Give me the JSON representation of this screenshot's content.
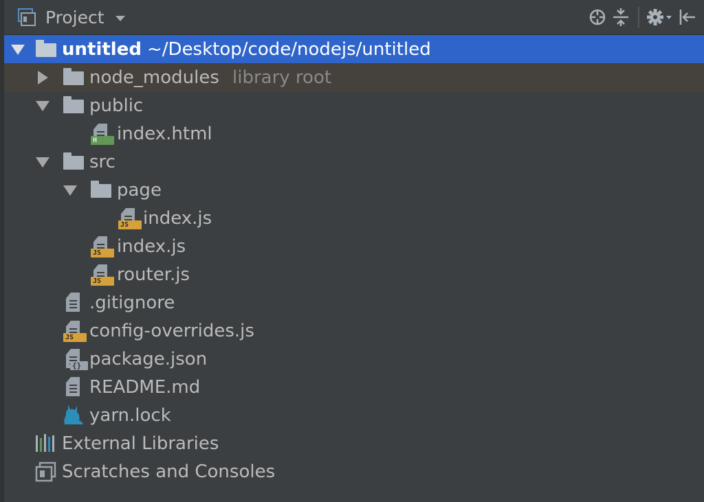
{
  "toolbar": {
    "title": "Project",
    "icons": [
      "project-view-icon",
      "dropdown-caret-icon",
      "locate-icon",
      "collapse-all-icon",
      "settings-gear-icon",
      "hide-panel-icon"
    ]
  },
  "tree": {
    "root": {
      "name": "untitled",
      "path": "~/Desktop/code/nodejs/untitled"
    },
    "node_modules": {
      "name": "node_modules",
      "note": "library root"
    },
    "public": {
      "name": "public",
      "index_html": "index.html"
    },
    "src": {
      "name": "src",
      "page": {
        "name": "page",
        "index_js": "index.js"
      },
      "index_js": "index.js",
      "router_js": "router.js"
    },
    "gitignore": ".gitignore",
    "config_overrides": "config-overrides.js",
    "package_json": "package.json",
    "readme": "README.md",
    "yarn_lock": "yarn.lock",
    "external_libraries": "External Libraries",
    "scratches": "Scratches and Consoles"
  },
  "badges": {
    "js": "JS",
    "html": "H",
    "json": "{}"
  },
  "colors": {
    "background": "#3c3f41",
    "selection": "#2f65ca",
    "library_root_highlight": "#45413c",
    "text": "#bbbbbb",
    "muted_text": "#8a8a8a",
    "js_badge": "#d6a13a",
    "html_badge": "#629755",
    "yarn_icon": "#2c8ebb",
    "libraries_icon_colors": [
      "#a9b2ba",
      "#629755",
      "#2c8ebb",
      "#a9b2ba"
    ]
  }
}
